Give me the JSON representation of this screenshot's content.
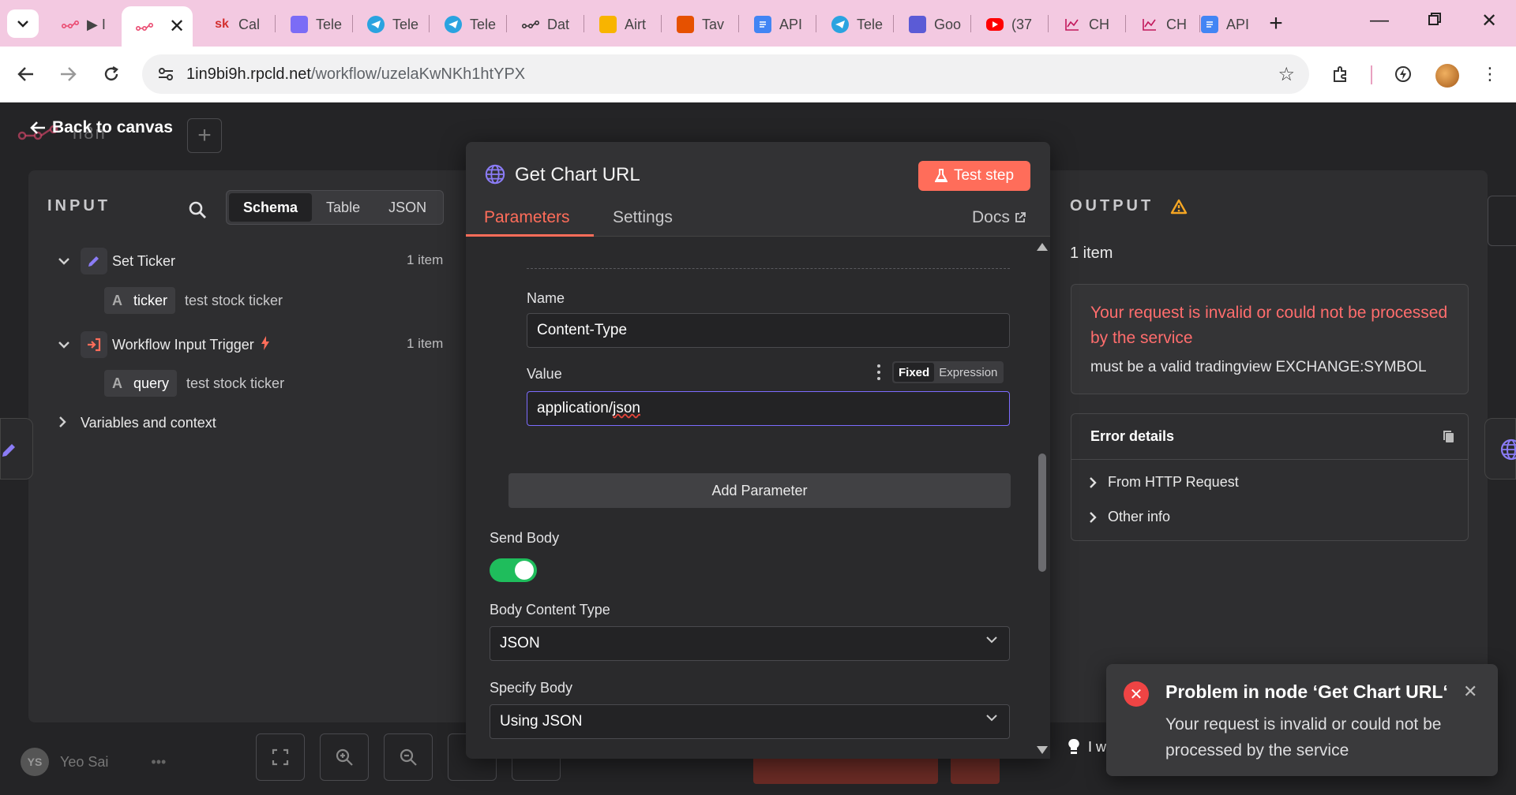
{
  "browser": {
    "tabs": [
      {
        "title": "▶ I",
        "icon": "n8n-icon",
        "color": "#ea4b71"
      },
      {
        "title": "",
        "icon": "n8n-icon",
        "color": "#ea4b71",
        "active": true
      },
      {
        "title": "Cal",
        "icon": "sk-icon",
        "color": "#d32f2f"
      },
      {
        "title": "Tele",
        "icon": "workflow-icon",
        "color": "#7b6cf6"
      },
      {
        "title": "Tele",
        "icon": "telegram-icon",
        "color": "#2aa3e0"
      },
      {
        "title": "Tele",
        "icon": "telegram-icon",
        "color": "#2aa3e0"
      },
      {
        "title": "Dat",
        "icon": "n8n-icon",
        "color": "#333333"
      },
      {
        "title": "Airt",
        "icon": "airtable-icon",
        "color": "#f8b400"
      },
      {
        "title": "Tav",
        "icon": "tavily-icon",
        "color": "#e65100"
      },
      {
        "title": "API",
        "icon": "docs-icon",
        "color": "#4285f4"
      },
      {
        "title": "Tele",
        "icon": "telegram-icon",
        "color": "#2aa3e0"
      },
      {
        "title": "Goo",
        "icon": "gemini-icon",
        "color": "#5b5bd6"
      },
      {
        "title": "(37",
        "icon": "youtube-icon",
        "color": "#ff0000"
      },
      {
        "title": "CH",
        "icon": "chart-icon",
        "color": "#c2185b"
      },
      {
        "title": "CH",
        "icon": "chart-icon",
        "color": "#c2185b"
      },
      {
        "title": "API",
        "icon": "docs-icon",
        "color": "#4285f4"
      }
    ],
    "url_host": "1in9bi9h.rpcld.net",
    "url_path": "/workflow/uzelaKwNKh1htYPX"
  },
  "canvas": {
    "back_label": "Back to canvas",
    "logo_text": "n8n",
    "user_initials": "YS",
    "user_name": "Yeo Sai",
    "hint_text": "I w"
  },
  "input": {
    "title": "INPUT",
    "views": [
      "Schema",
      "Table",
      "JSON"
    ],
    "selected_view": "Schema",
    "nodes": [
      {
        "name": "Set Ticker",
        "count": "1 item",
        "field": "ticker",
        "field_type": "A",
        "value": "test stock ticker"
      },
      {
        "name": "Workflow Input Trigger",
        "count": "1 item",
        "field": "query",
        "field_type": "A",
        "value": "test stock ticker"
      }
    ],
    "variables_label": "Variables and context"
  },
  "node": {
    "title": "Get Chart URL",
    "test_label": "Test step",
    "tabs": [
      "Parameters",
      "Settings"
    ],
    "docs_label": "Docs",
    "header_name_label": "Name",
    "header_name_value": "Content-Type",
    "header_value_label": "Value",
    "header_value": "application/json",
    "mode_options": [
      "Fixed",
      "Expression"
    ],
    "mode_selected": "Fixed",
    "add_param_label": "Add Parameter",
    "send_body_label": "Send Body",
    "send_body_on": true,
    "body_type_label": "Body Content Type",
    "body_type_value": "JSON",
    "specify_body_label": "Specify Body",
    "specify_body_value": "Using JSON"
  },
  "output": {
    "title": "OUTPUT",
    "count": "1 item",
    "error_title": "Your request is invalid or could not be processed by the service",
    "error_desc": "must be a valid tradingview EXCHANGE:SYMBOL",
    "details_title": "Error details",
    "details_rows": [
      "From HTTP Request",
      "Other info"
    ]
  },
  "toast": {
    "title": "Problem in node ‘Get Chart URL‘",
    "message": "Your request is invalid or could not be processed by the service"
  },
  "colors": {
    "accent": "#ff6d5a",
    "error": "#ff6d6d",
    "toggle_on": "#1fbd5c",
    "warning": "#f5a623"
  }
}
